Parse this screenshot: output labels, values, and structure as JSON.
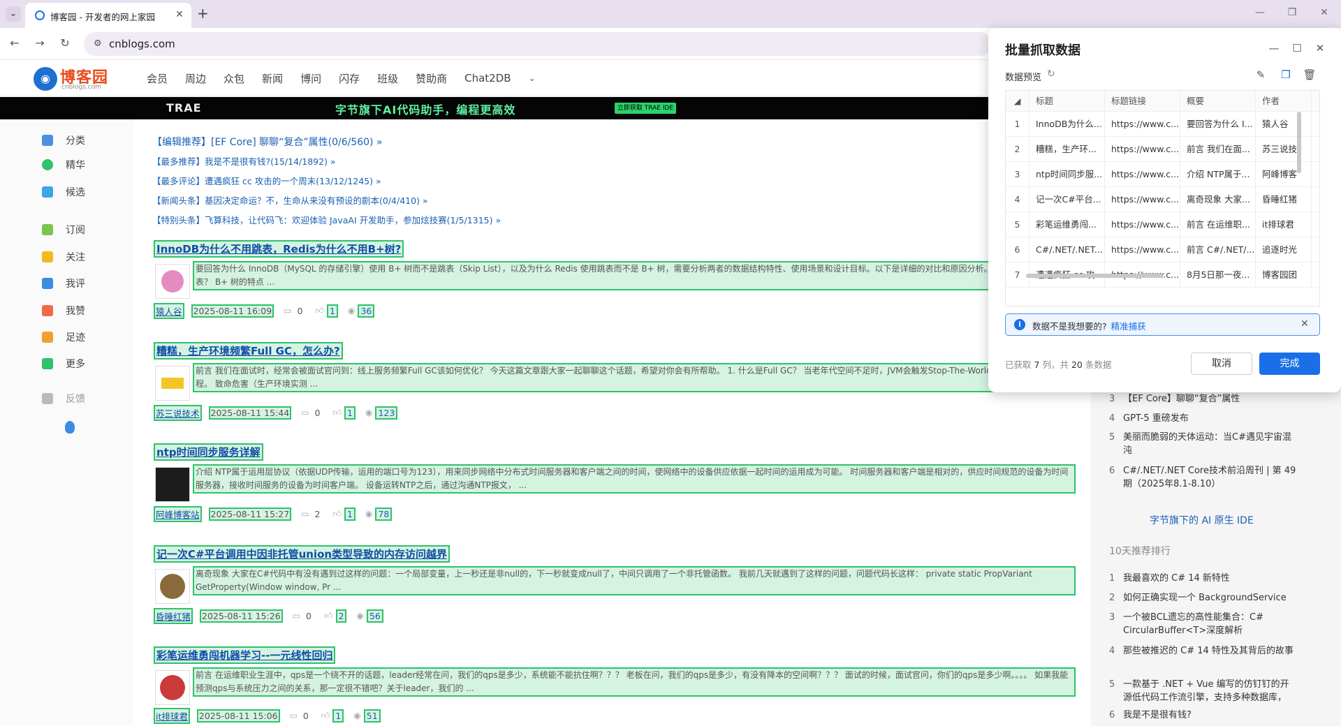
{
  "browser": {
    "tab_title": "博客园 - 开发者的网上家园",
    "url": "cnblogs.com"
  },
  "site": {
    "logo_name": "博客园",
    "logo_sub": "cnblogs.com",
    "menu": [
      "会员",
      "周边",
      "众包",
      "新闻",
      "博问",
      "闪存",
      "班级",
      "赞助商",
      "Chat2DB"
    ],
    "banner_brand": "TRAE",
    "banner_text": "字节旗下AI代码助手，编程更高效",
    "banner_button": "立即获取 TRAE IDE"
  },
  "leftnav": [
    {
      "label": "分类",
      "color": "#4a90e2"
    },
    {
      "label": "精华",
      "color": "#2ec26a"
    },
    {
      "label": "候选",
      "color": "#3aa7e8"
    },
    {
      "label": "订阅",
      "color": "#7cc44e"
    },
    {
      "label": "关注",
      "color": "#f5b820"
    },
    {
      "label": "我评",
      "color": "#3a8de0"
    },
    {
      "label": "我赞",
      "color": "#f06a4a"
    },
    {
      "label": "足迹",
      "color": "#f0a030"
    },
    {
      "label": "更多",
      "color": "#2ec26a"
    },
    {
      "label": "反馈",
      "color": "#aaaaaa"
    }
  ],
  "recommend": [
    {
      "tag": "【编辑推荐】",
      "text": "[EF Core] 聊聊“复合”属性(0/6/560) »"
    },
    {
      "tag": "【最多推荐】",
      "text": "我是不是很有钱?(15/14/1892) »"
    },
    {
      "tag": "【最多评论】",
      "text": "遭遇疯狂 cc 攻击的一个周末(13/12/1245) »"
    },
    {
      "tag": "【新闻头条】",
      "text": "基因决定命运？不，生命从来没有预设的剧本(0/4/410) »"
    },
    {
      "tag": "【特别头条】",
      "text": "飞算科技，让代码飞：欢迎体验 JavaAI 开发助手，参加炫技赛(1/5/1315) »"
    }
  ],
  "posts": [
    {
      "title": "InnoDB为什么不用跳表，Redis为什么不用B+树?",
      "summary": "要回答为什么 InnoDB（MySQL 的存储引擎）使用 B+ 树而不是跳表（Skip List），以及为什么 Redis 使用跳表而不是 B+ 树，需要分析两者的数据结构特性、使用场景和设计目标。以下是详细的对比和原因分析。用 B+ 树而不是跳表？ B+ 树的特点 ...",
      "author": "猿人谷",
      "date": "2025-08-11 16:09",
      "comments": "0",
      "likes": "1",
      "views": "36"
    },
    {
      "title": "糟糕，生产环境频繁Full GC，怎么办?",
      "summary": "前言 我们在面试时，经常会被面试官问到：线上服务频繁Full GC该如何优化？ 今天这篇文章跟大家一起聊聊这个话题，希望对你会有所帮助。 1. 什么是Full GC？ 当老年代空间不足时，JVM会触发Stop-The-World C），暂停所有应用线程。 致命危害（生产环境实测 ...",
      "author": "苏三说技术",
      "date": "2025-08-11 15:44",
      "comments": "0",
      "likes": "1",
      "views": "123"
    },
    {
      "title": "ntp时间同步服务详解",
      "summary": "介绍 NTP属于运用层协议（依据UDP传输，运用的端口号为123），用来同步网络中分布式时间服务器和客户端之间的时间，使网络中的设备供应依据一起时间的运用成为可能。 时间服务器和客户端是相对的，供应时间规范的设备为时间服务器，接收时间服务的设备为时间客户端。 设备运转NTP之后，通过沟通NTP报文， ...",
      "author": "阿峰博客站",
      "date": "2025-08-11 15:27",
      "comments": "2",
      "likes": "1",
      "views": "78"
    },
    {
      "title": "记一次C#平台调用中因非托管union类型导致的内存访问越界",
      "summary": "离奇现象 大家在C#代码中有没有遇到过这样的问题：一个局部变量，上一秒还是非null的，下一秒就变成null了，中间只调用了一个非托管函数。 我前几天就遇到了这样的问题，问题代码长这样： private static PropVariant GetProperty(Window window, Pr ...",
      "author": "昏睡红猪",
      "date": "2025-08-11 15:26",
      "comments": "0",
      "likes": "2",
      "views": "56"
    },
    {
      "title": "彩笔运维勇闯机器学习--一元线性回归",
      "summary": "前言 在运维职业生涯中，qps是一个绕不开的话题，leader经常在问，我们的qps是多少，系统能不能抗住啊？？？ 老板在问，我们的qps是多少，有没有降本的空间啊？？？ 面试的时候，面试官问，你们的qps是多少啊。。。。 如果我能预测qps与系统压力之间的关系，那一定很不错吧？关于leader，我们的 ...",
      "author": "it排球君",
      "date": "2025-08-11 15:06",
      "comments": "0",
      "likes": "1",
      "views": "51"
    }
  ],
  "rightcol": {
    "top_list": [
      {
        "num": "3",
        "text": "【EF Core】聊聊“复合”属性"
      },
      {
        "num": "4",
        "text": "GPT-5 重磅发布"
      },
      {
        "num": "5",
        "text": "美丽而脆弱的天体运动：当C#遇见宇宙混沌"
      },
      {
        "num": "6",
        "text": "C#/.NET/.NET Core技术前沿周刊 | 第 49 期（2025年8.1-8.10）"
      }
    ],
    "promo": "字节旗下的 AI 原生 IDE",
    "ranking_title": "10天推荐排行",
    "ranking": [
      {
        "num": "1",
        "text": "我最喜欢的 C# 14 新特性"
      },
      {
        "num": "2",
        "text": "如何正确实现一个 BackgroundService"
      },
      {
        "num": "3",
        "text": "一个被BCL遗忘的高性能集合：C# CircularBuffer<T>深度解析"
      },
      {
        "num": "4",
        "text": "那些被推迟的 C# 14 特性及其背后的故事"
      },
      {
        "num": "5",
        "text": "一款基于 .NET + Vue 编写的仿钉钉的开源低代码工作流引擎，支持多种数据库，"
      },
      {
        "num": "6",
        "text": "我是不是很有钱?"
      }
    ]
  },
  "panel": {
    "title": "批量抓取数据",
    "subtitle": "数据预览",
    "columns": [
      "标题",
      "标题链接",
      "概要",
      "作者"
    ],
    "rows": [
      [
        "1",
        "InnoDB为什么...",
        "https://www.c...",
        "要回答为什么 I...",
        "猿人谷"
      ],
      [
        "2",
        "糟糕，生产环...",
        "https://www.c...",
        "前言 我们在面...",
        "苏三说技"
      ],
      [
        "3",
        "ntp时间同步服...",
        "https://www.c...",
        "介绍 NTP属于...",
        "阿峰博客"
      ],
      [
        "4",
        "记一次C#平台...",
        "https://www.c...",
        "离奇现象 大家...",
        "昏睡红猪"
      ],
      [
        "5",
        "彩笔运维勇闯...",
        "https://www.c...",
        "前言 在运维职...",
        "it排球君"
      ],
      [
        "6",
        "C#/.NET/.NET...",
        "https://www.c...",
        "前言 C#/.NET/...",
        "追逐时光"
      ],
      [
        "7",
        "遭遇疯狂 cc 攻...",
        "https://www.c...",
        "8月5日那一夜...",
        "博客园团"
      ]
    ],
    "info_text": "数据不是我想要的?",
    "info_link": "精准捕获",
    "count_pre": "已获取",
    "count_cols": "7",
    "count_mid": "列，共",
    "count_rows": "20",
    "count_post": "条数据",
    "cancel": "取消",
    "done": "完成"
  }
}
